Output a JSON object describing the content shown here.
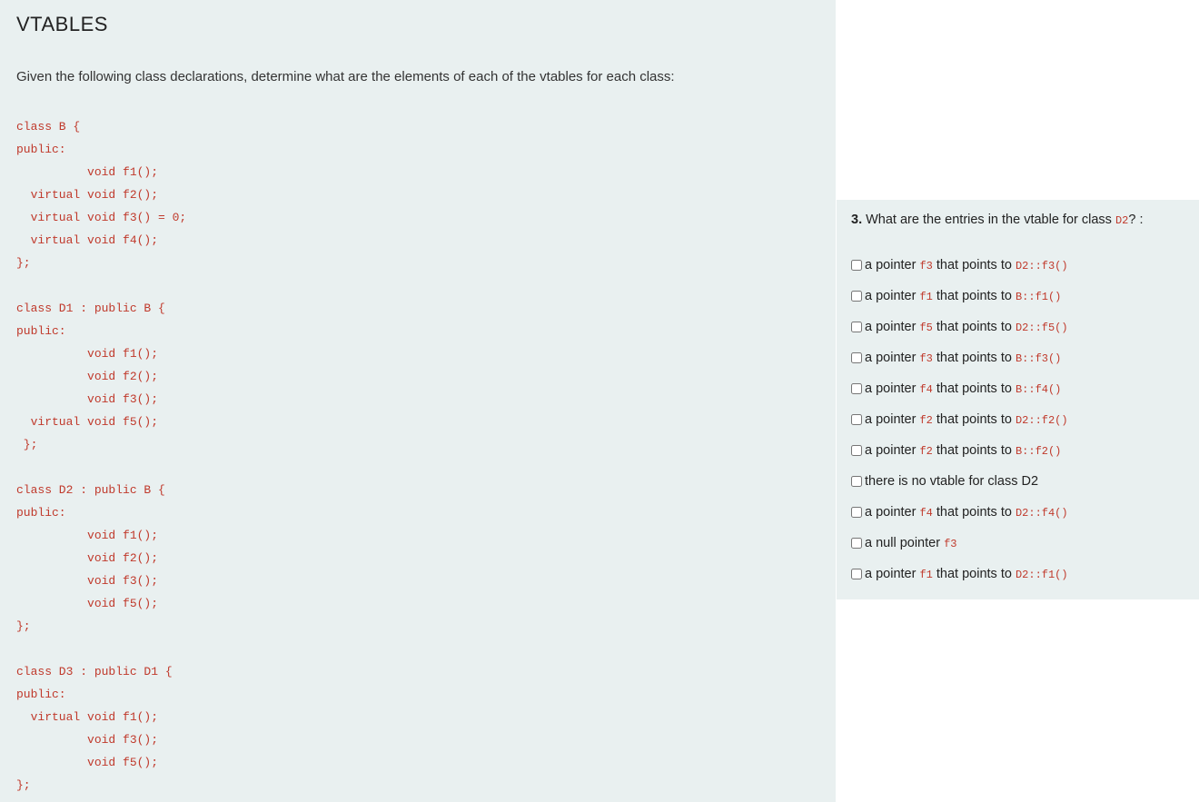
{
  "left": {
    "heading": "VTABLES",
    "intro": "Given the following class declarations, determine what are the elements of each of the vtables for each class:",
    "code": "class B {\npublic:\n          void f1();\n  virtual void f2();\n  virtual void f3() = 0;\n  virtual void f4();\n};\n\nclass D1 : public B {\npublic:\n          void f1();\n          void f2();\n          void f3();\n  virtual void f5();\n };\n\nclass D2 : public B {\npublic:\n          void f1();\n          void f2();\n          void f3();\n          void f5();\n};\n\nclass D3 : public D1 {\npublic:\n  virtual void f1();\n          void f3();\n          void f5();\n};"
  },
  "question": {
    "number": "3.",
    "text_before": " What are the entries in the vtable for class ",
    "class_code": "D2",
    "text_after": "? :",
    "options": [
      {
        "prefix": "a pointer ",
        "code1": "f3",
        "mid": " that points to ",
        "code2": "D2::f3()"
      },
      {
        "prefix": "a pointer ",
        "code1": "f1",
        "mid": " that points to ",
        "code2": "B::f1()"
      },
      {
        "prefix": "a pointer ",
        "code1": "f5",
        "mid": " that points to ",
        "code2": "D2::f5()"
      },
      {
        "prefix": "a pointer ",
        "code1": "f3",
        "mid": " that points to ",
        "code2": "B::f3()"
      },
      {
        "prefix": "a pointer ",
        "code1": "f4",
        "mid": " that points to ",
        "code2": "B::f4()"
      },
      {
        "prefix": "a pointer ",
        "code1": "f2",
        "mid": " that points to ",
        "code2": "D2::f2()"
      },
      {
        "prefix": "a pointer ",
        "code1": "f2",
        "mid": " that points to ",
        "code2": "B::f2()"
      },
      {
        "plain": "there is no vtable for class D2"
      },
      {
        "prefix": "a pointer ",
        "code1": "f4",
        "mid": " that points to ",
        "code2": "D2::f4()"
      },
      {
        "prefix": "a null pointer ",
        "code1": "f3"
      },
      {
        "prefix": "a pointer ",
        "code1": "f1",
        "mid": " that points to ",
        "code2": "D2::f1()"
      }
    ]
  }
}
